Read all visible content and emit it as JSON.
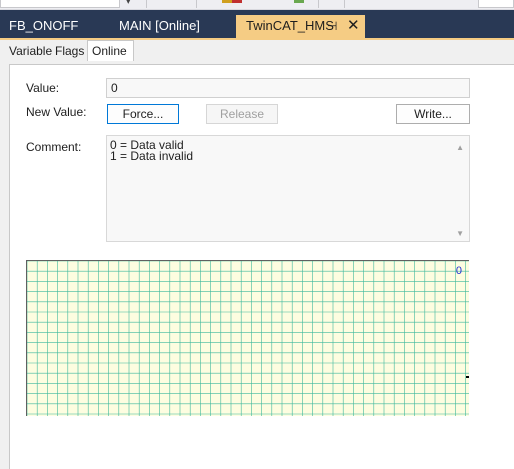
{
  "toolbar": {
    "accent": "#c8c8cc"
  },
  "tabs": [
    {
      "label": "FB_ONOFF"
    },
    {
      "label": "MAIN [Online]"
    },
    {
      "label": "TwinCAT_HMS",
      "pin_glyph": "⊣",
      "close_glyph": "✕",
      "active": true
    }
  ],
  "subtabs": [
    {
      "label": "Variable"
    },
    {
      "label": "Flags"
    },
    {
      "label": "Online",
      "active": true
    }
  ],
  "online": {
    "value_label": "Value:",
    "value": "0",
    "new_value_label": "New Value:",
    "force_label": "Force...",
    "release_label": "Release",
    "write_label": "Write...",
    "comment_label": "Comment:",
    "comment_lines": [
      "0 = Data valid",
      "1 = Data invalid"
    ],
    "scroll_up_glyph": "▲",
    "scroll_down_glyph": "▼"
  },
  "trend": {
    "current_value": "0",
    "background": "#fdfde0",
    "grid_color": "#3cb89c"
  },
  "colors": {
    "tab_strip": "#293955",
    "active_tab": "#f5cc84",
    "focus_border": "#0078d7"
  }
}
